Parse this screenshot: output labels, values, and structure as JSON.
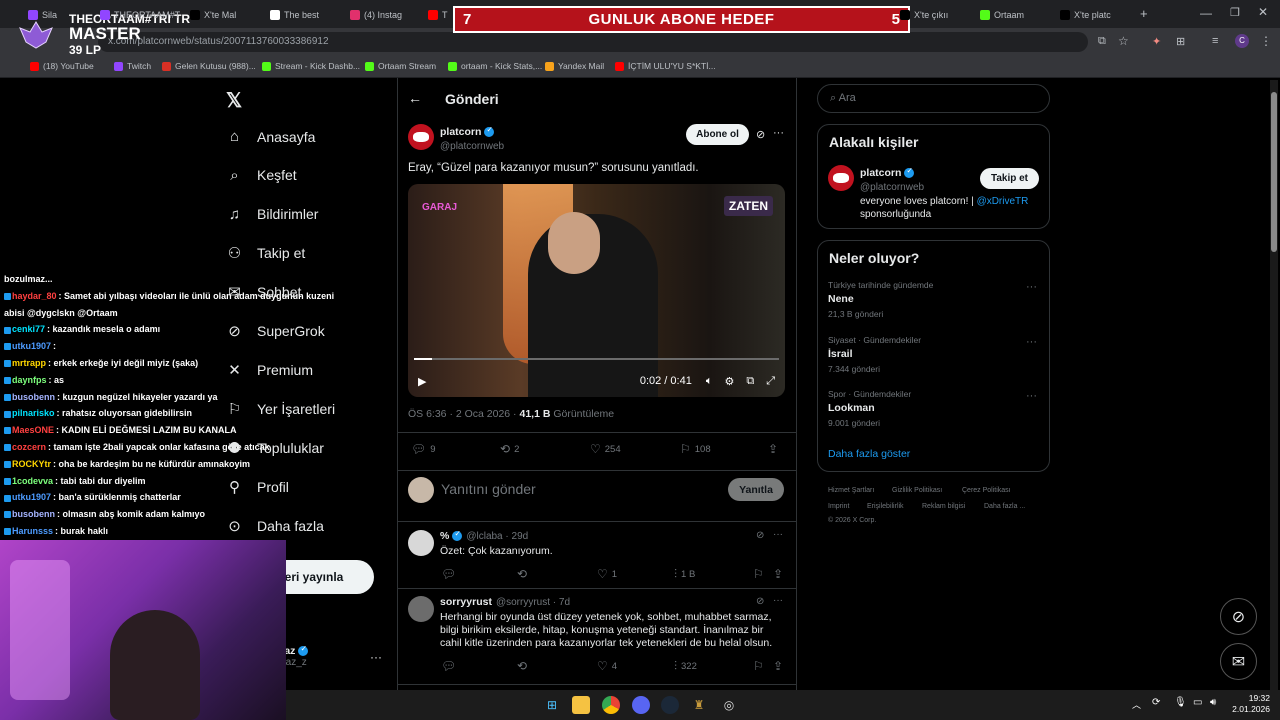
{
  "browser": {
    "tabs": [
      {
        "label": "Sila",
        "color": "#9146ff"
      },
      {
        "label": "THEORTAAM#TRI TR",
        "color": "#9146ff"
      },
      {
        "label": "X'te Mal",
        "color": "#000000"
      },
      {
        "label": "The best",
        "color": "#ffffff"
      },
      {
        "label": "(4) Instag",
        "color": "#e1306c"
      },
      {
        "label": "Th",
        "color": "#ff0000"
      },
      {
        "label": "X'te çıkıı",
        "color": "#000000"
      },
      {
        "label": "Ortaam",
        "color": "#53fc18"
      },
      {
        "label": "X'te platc",
        "color": "#000000"
      }
    ],
    "url": "x.com/platcornweb/status/2007113760033386912",
    "bookmarks": [
      {
        "label": "(18) YouTube",
        "color": "#ff0000"
      },
      {
        "label": "Twitch",
        "color": "#9146ff"
      },
      {
        "label": "Gelen Kutusu (988)...",
        "color": "#d93025"
      },
      {
        "label": "Stream - Kick Dashb...",
        "color": "#53fc18"
      },
      {
        "label": "Ortaam Stream",
        "color": "#53fc18"
      },
      {
        "label": "ortaam - Kick Stats,...",
        "color": "#53fc18"
      },
      {
        "label": "Yandex Mail",
        "color": "#f7a21b"
      },
      {
        "label": "İÇTİM ULU'YU S*KTİ...",
        "color": "#ff0000"
      }
    ]
  },
  "overlay": {
    "goal_left": "7",
    "goal_title": "GUNLUK ABONE HEDEF",
    "goal_right": "5",
    "rank_title": "THEORTAAM#TRI TR",
    "rank": "MASTER",
    "lp": "39 LP"
  },
  "chat": [
    {
      "user": "",
      "msg": "bozulmaz...",
      "color": "#ffffff"
    },
    {
      "user": "haydar_80",
      "msg": ": Samet abi yılbaşı videoları ile ünlü olan adam duygunun kuzeni",
      "color": "#ff4040"
    },
    {
      "user": "",
      "msg": "abisi @dygclskn @Ortaam",
      "color": "#ffffff"
    },
    {
      "user": "cenki77",
      "msg": ": kazandık mesela o adamı",
      "color": "#00e5ff"
    },
    {
      "user": "utku1907",
      "msg": ":",
      "color": "#4d9bff"
    },
    {
      "user": "mrtrapp",
      "msg": ": erkek erkeğe iyi değil miyiz (şaka)",
      "color": "#ffd700"
    },
    {
      "user": "daynfps",
      "msg": ": as",
      "color": "#7dff7d"
    },
    {
      "user": "busobenn",
      "msg": ": kuzgun negüzel hikayeler yazardı ya",
      "color": "#a5b4ff"
    },
    {
      "user": "pilnarisko",
      "msg": ": rahatsız oluyorsan gidebilirsin",
      "color": "#00e5ff"
    },
    {
      "user": "MaesONE",
      "msg": ": KADIN ELİ DEĞMESİ LAZIM BU KANALA",
      "color": "#ff4040"
    },
    {
      "user": "cozcern",
      "msg": ": tamam işte 2bali yapcak onlar kafasına göre atıcak",
      "color": "#ff4040"
    },
    {
      "user": "ROCKYtr",
      "msg": ": oha be kardeşim bu ne küfürdür amınakoyim",
      "color": "#ffd700"
    },
    {
      "user": "1codevva",
      "msg": ": tabi tabi dur diyelim",
      "color": "#7dff7d"
    },
    {
      "user": "utku1907",
      "msg": ": ban'a sürüklenmiş chatterlar",
      "color": "#4d9bff"
    },
    {
      "user": "busobenn",
      "msg": ": olmasın abş komik adam kalmıyo",
      "color": "#a5b4ff"
    },
    {
      "user": "Harunsss",
      "msg": ": burak haklı",
      "color": "#4d9bff"
    }
  ],
  "nav": {
    "items": [
      {
        "label": "Anasayfa",
        "icon": "home-icon"
      },
      {
        "label": "Keşfet",
        "icon": "search-icon"
      },
      {
        "label": "Bildirimler",
        "icon": "bell-icon"
      },
      {
        "label": "Takip et",
        "icon": "follow-icon"
      },
      {
        "label": "Sohbet",
        "icon": "chat-icon"
      },
      {
        "label": "SuperGrok",
        "icon": "grok-icon"
      },
      {
        "label": "Premium",
        "icon": "x-icon"
      },
      {
        "label": "Yer İşaretleri",
        "icon": "bookmark-icon"
      },
      {
        "label": "Topluluklar",
        "icon": "communities-icon"
      },
      {
        "label": "Profil",
        "icon": "profile-icon"
      },
      {
        "label": "Daha fazla",
        "icon": "more-icon"
      }
    ],
    "post_button": "eri yayınla",
    "user_name": "etyilmaz",
    "user_handle": "netyilmaz_z"
  },
  "post": {
    "header": "Gönderi",
    "author": "platcorn",
    "handle": "@platcornweb",
    "follow_label": "Abone ol",
    "text": "Eray, “Güzel para kazanıyor musun?” sorusunu yanıtladı.",
    "video_time": "0:02 / 0:41",
    "video_progress": 0.05,
    "video_brand": "GARAJ",
    "video_badge": "ZATEN",
    "time": "ÖS 6:36 · 2 Oca 2026 · ",
    "views": "41,1 B",
    "views_label": " Görüntüleme",
    "replies": "9",
    "reposts": "2",
    "likes": "254",
    "bookmarks": "108",
    "reply_placeholder": "Yanıtını gönder",
    "reply_button": "Yanıtla"
  },
  "replies": [
    {
      "name": "%",
      "handle": "@lclaba · 29d",
      "text": "Özet: Çok kazanıyorum.",
      "replies": "",
      "reposts": "",
      "likes": "1",
      "views": "1 B"
    },
    {
      "name": "sorryyrust",
      "handle": "@sorryyrust · 7d",
      "text": "Herhangi bir oyunda üst düzey yetenek yok, sohbet, muhabbet sarmaz, bilgi birikim eksilerde, hitap, konuşma yeteneği standart. İnanılmaz bir cahil kitle üzerinden para kazanıyorlar tek yetenekleri de bu helal olsun.",
      "replies": "",
      "reposts": "",
      "likes": "4",
      "views": "322"
    }
  ],
  "right": {
    "search_placeholder": "Ara",
    "related_title": "Alakalı kişiler",
    "related_name": "platcorn",
    "related_handle": "@platcornweb",
    "related_follow": "Takip et",
    "related_bio": "everyone loves platcorn! | ",
    "related_bio_link": "@xDriveTR",
    "related_bio2": "sponsorluğunda",
    "trends_title": "Neler oluyor?",
    "trends": [
      {
        "meta": "Türkiye tarihinde gündemde",
        "title": "Nene",
        "count": "21,3 B gönderi"
      },
      {
        "meta": "Siyaset · Gündemdekiler",
        "title": "İsrail",
        "count": "7.344 gönderi"
      },
      {
        "meta": "Spor · Gündemdekiler",
        "title": "Lookman",
        "count": "9.001 gönderi"
      }
    ],
    "show_more": "Daha fazla göster",
    "footer1": [
      "Hizmet Şartları",
      "Gizlilik Politikası",
      "Çerez Politikası"
    ],
    "footer2": [
      "Imprint",
      "Erişilebilirlik",
      "Reklam bilgisi",
      "Daha fazla ..."
    ],
    "copyright": "© 2026 X Corp."
  },
  "taskbar": {
    "time": "19:32",
    "date": "2.01.2026"
  },
  "colors": {
    "accent": "#1d9bf0",
    "goal_bg": "#b5121b"
  }
}
